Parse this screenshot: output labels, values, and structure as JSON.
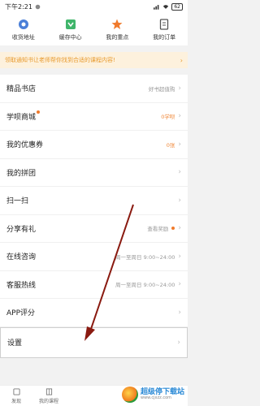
{
  "status_bar": {
    "time": "下午2:21",
    "battery": "62"
  },
  "quick_actions": [
    {
      "label": "收货地址",
      "icon": "location-icon",
      "color": "#4a7fd8"
    },
    {
      "label": "缓存中心",
      "icon": "download-icon",
      "color": "#3fb56a"
    },
    {
      "label": "我的重点",
      "icon": "star-icon",
      "color": "#f07a2c"
    },
    {
      "label": "我的订单",
      "icon": "order-icon",
      "color": "#555555"
    }
  ],
  "notice": {
    "text": "领取通知书让老师帮你找到合适的课程内容!"
  },
  "menu": {
    "items": [
      {
        "title": "精品书店",
        "hint": "好书超值购"
      },
      {
        "title": "学呗商城",
        "hint": "0学呗"
      },
      {
        "title": "我的优惠券",
        "hint": "0张"
      },
      {
        "title": "我的拼团",
        "hint": ""
      },
      {
        "title": "扫一扫",
        "hint": ""
      },
      {
        "title": "分享有礼",
        "hint": "查看奖励"
      },
      {
        "title": "在线咨询",
        "hint": "周一至周日 9:00~24:00"
      },
      {
        "title": "客服热线",
        "hint": "周一至周日 9:00~24:00"
      },
      {
        "title": "APP评分",
        "hint": ""
      }
    ],
    "settings": {
      "title": "设置"
    }
  },
  "tabbar": {
    "tabs": [
      {
        "label": "发现"
      },
      {
        "label": "我的课程"
      }
    ]
  },
  "watermark": {
    "main": "超级停下载站",
    "sub": "www.cjxzz.com"
  },
  "colors": {
    "accent": "#f07a2c",
    "notice_bg": "#fdf1dd",
    "arrow": "#8a1a10"
  }
}
